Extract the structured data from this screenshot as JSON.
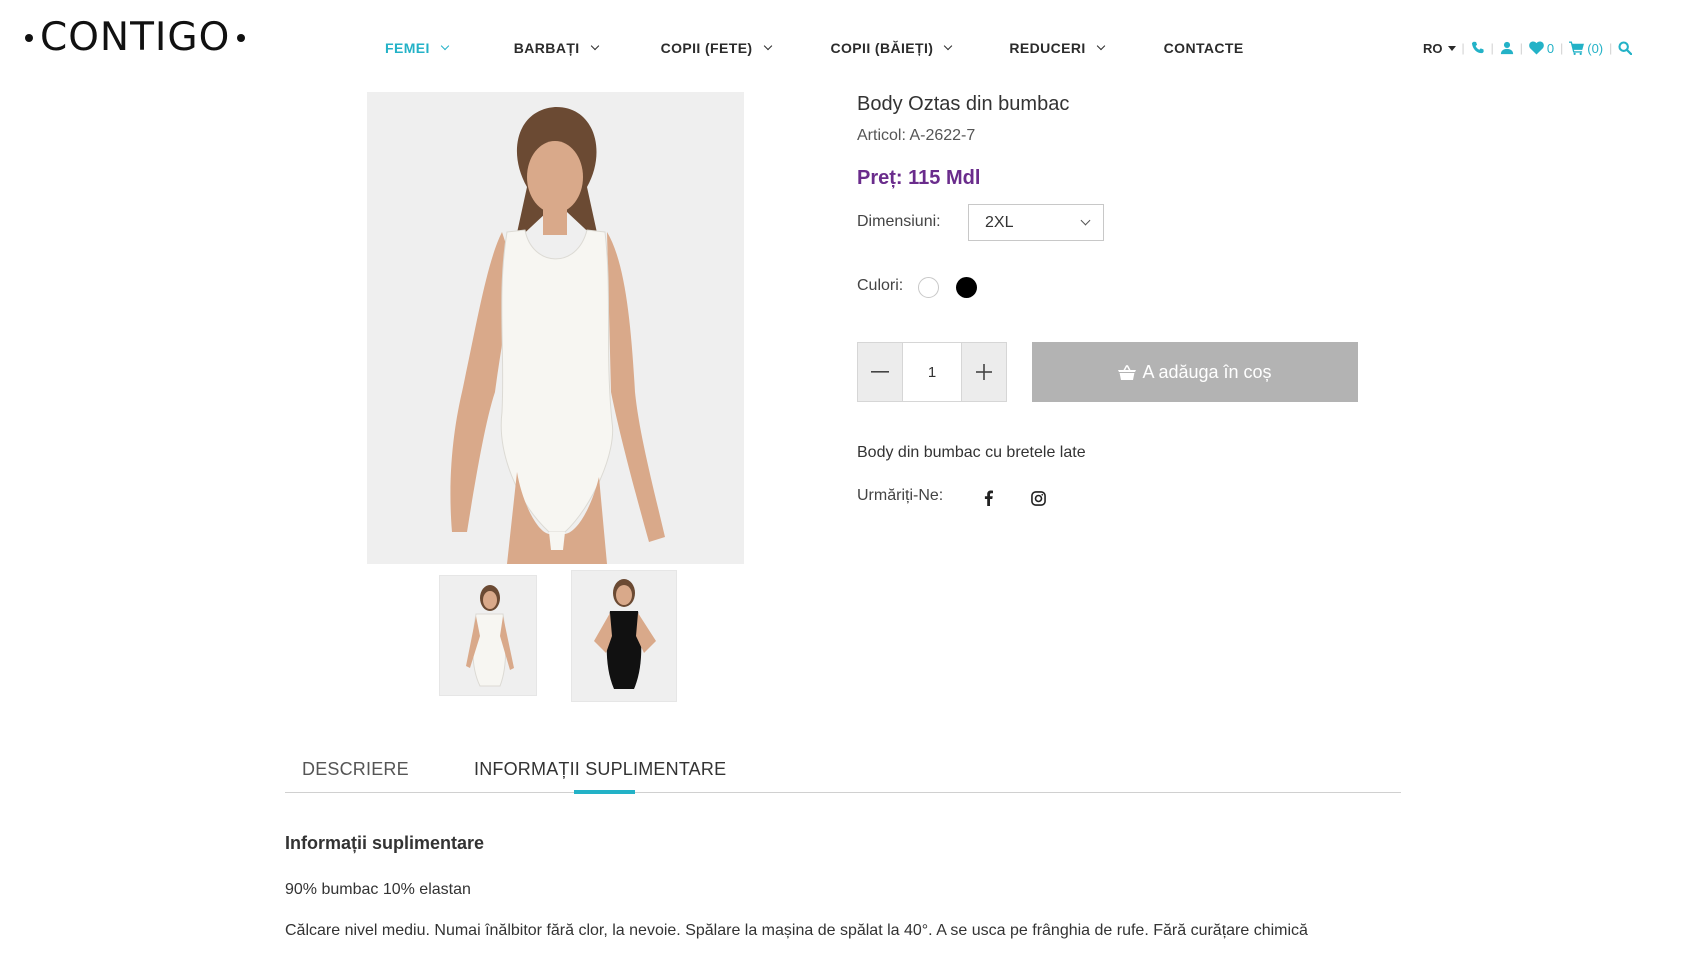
{
  "brand": {
    "name": "CONTIGO"
  },
  "nav": {
    "items": [
      {
        "label": "FEMEI",
        "has_dropdown": true,
        "active": true
      },
      {
        "label": "BARBAȚI",
        "has_dropdown": true
      },
      {
        "label": "COPII (FETE)",
        "has_dropdown": true
      },
      {
        "label": "COPII (BĂIEȚI)",
        "has_dropdown": true
      },
      {
        "label": "REDUCERI",
        "has_dropdown": true
      },
      {
        "label": "CONTACTE",
        "has_dropdown": false
      }
    ]
  },
  "tools": {
    "language": "RO",
    "wishlist_count": "0",
    "cart_count": "(0)",
    "icons": [
      "phone-icon",
      "user-icon",
      "heart-icon",
      "cart-icon",
      "search-icon"
    ]
  },
  "product": {
    "title": "Body Oztas din bumbac",
    "sku": "Articol: A-2622-7",
    "price": "Preț: 115 Mdl",
    "size_label": "Dimensiuni:",
    "size_selected": "2XL",
    "colors_label": "Culori:",
    "colors": [
      "#ffffff",
      "#000000"
    ],
    "quantity": "1",
    "add_to_cart_label": "A adăuga în coș",
    "short_description": "Body din bumbac cu bretele late",
    "follow_label": "Urmăriți-Ne:"
  },
  "tabs": {
    "items": [
      {
        "label": "DESCRIERE"
      },
      {
        "label": "INFORMAȚII SUPLIMENTARE",
        "active": true
      }
    ]
  },
  "info": {
    "title": "Informații suplimentare",
    "composition": "90% bumbac 10% elastan",
    "care": "Călcare nivel mediu. Numai înălbitor fără clor, la nevoie. Spălare la mașina de spălat la 40°. A se usca pe frânghia de rufe. Fără curățare chimică"
  },
  "colors": {
    "accent": "#23b2c7",
    "price": "#6a2c8c",
    "button_disabled": "#b3b3b3"
  }
}
